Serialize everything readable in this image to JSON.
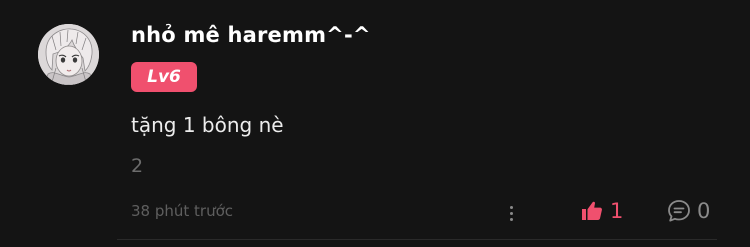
{
  "comment": {
    "username": "nhỏ mê haremm^-^",
    "level_badge": "Lv6",
    "text": "tặng 1 bông nè",
    "reply_count": "2",
    "timestamp": "38 phút trước",
    "likes": "1",
    "replies": "0"
  },
  "icons": {
    "avatar": "anime-character-avatar",
    "more": "more-vertical-icon",
    "like": "thumbs-up-icon",
    "reply": "speech-bubble-icon"
  },
  "colors": {
    "background": "#141414",
    "accent": "#f0506e",
    "muted_text": "#6c6c6c"
  }
}
